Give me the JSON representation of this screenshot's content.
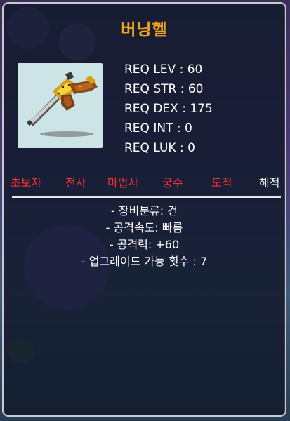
{
  "item": {
    "name": "버닝헬"
  },
  "requirements": [
    {
      "label": "REQ LEV : 60"
    },
    {
      "label": "REQ STR : 60"
    },
    {
      "label": "REQ DEX : 175"
    },
    {
      "label": "REQ INT : 0"
    },
    {
      "label": "REQ LUK : 0"
    }
  ],
  "jobs": [
    {
      "label": "초보자",
      "color": "#ff3030"
    },
    {
      "label": "전사",
      "color": "#ff3030"
    },
    {
      "label": "마법사",
      "color": "#ff3030"
    },
    {
      "label": "궁수",
      "color": "#ff3030"
    },
    {
      "label": "도적",
      "color": "#ff3030"
    },
    {
      "label": "해적",
      "color": "#ffffff"
    }
  ],
  "description": [
    {
      "text": "- 장비분류: 건"
    },
    {
      "text": "- 공격속도: 빠름"
    },
    {
      "text": "- 공격력: +60"
    },
    {
      "text": "- 업그레이드 가능 횟수 : 7"
    }
  ],
  "icon": {
    "name": "flintlock-pistol-icon",
    "background": "#cde4e6"
  },
  "colors": {
    "item_name": "#f2a51c",
    "panel_border": "#c9c9cf"
  }
}
